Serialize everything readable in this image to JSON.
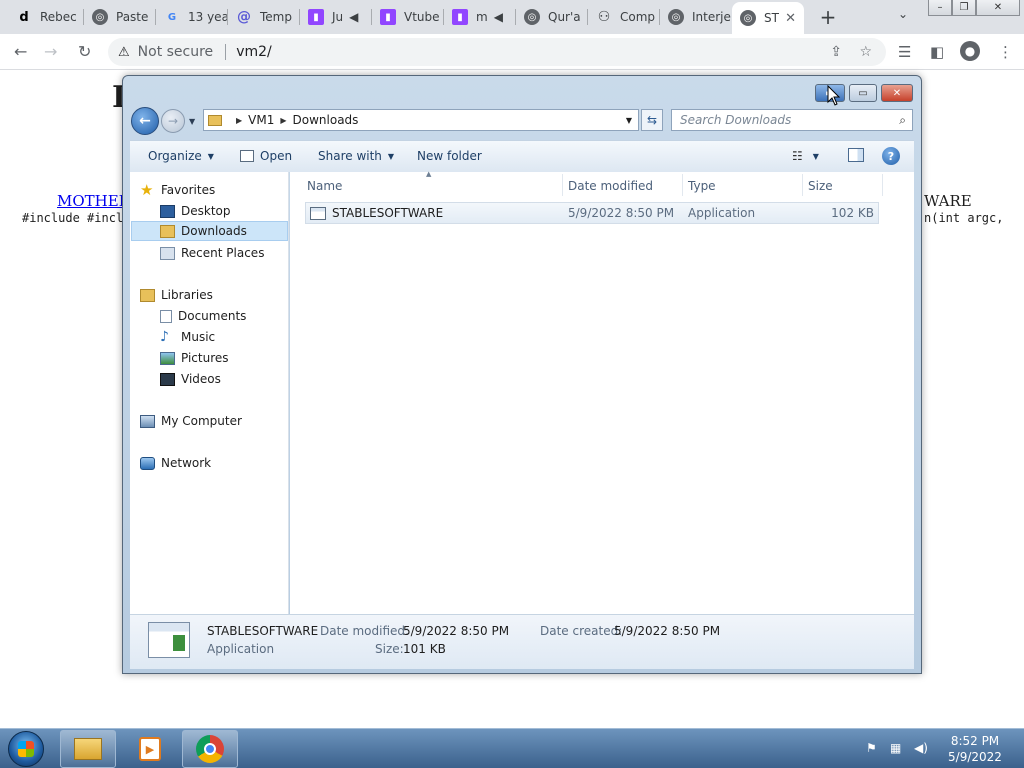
{
  "browser": {
    "tabs": [
      {
        "label": "Rebec",
        "favicon": "letter-d-icon",
        "fav_text": "d"
      },
      {
        "label": "Paste",
        "favicon": "globe-icon"
      },
      {
        "label": "13 yea",
        "favicon": "google-g-icon",
        "fav_text": "G"
      },
      {
        "label": "Temp",
        "favicon": "at-sign-icon",
        "fav_text": "@"
      },
      {
        "label": "Ju",
        "favicon": "twitch-icon",
        "audio": true
      },
      {
        "label": "Vtube",
        "favicon": "twitch-icon"
      },
      {
        "label": "m",
        "favicon": "twitch-icon",
        "audio": true
      },
      {
        "label": "Qur'a",
        "favicon": "globe-icon"
      },
      {
        "label": "Comp",
        "favicon": "app-icon"
      },
      {
        "label": "Interje",
        "favicon": "globe-icon"
      },
      {
        "label": "ST",
        "favicon": "globe-icon",
        "active": true
      }
    ],
    "address": {
      "security": "Not secure",
      "url": "vm2/"
    }
  },
  "webpage": {
    "heading_fragment": "I",
    "link_left": "MOTHER",
    "text_right": "WARE",
    "code_left": "#include #incl",
    "code_right": "n(int argc,"
  },
  "explorer": {
    "breadcrumb": [
      "VM1",
      "Downloads"
    ],
    "search_placeholder": "Search Downloads",
    "commands": {
      "organize": "Organize",
      "open": "Open",
      "share": "Share with",
      "new_folder": "New folder"
    },
    "nav": {
      "favorites": "Favorites",
      "desktop": "Desktop",
      "downloads": "Downloads",
      "recent": "Recent Places",
      "libraries": "Libraries",
      "documents": "Documents",
      "music": "Music",
      "pictures": "Pictures",
      "videos": "Videos",
      "computer": "My Computer",
      "network": "Network"
    },
    "columns": {
      "name": "Name",
      "date": "Date modified",
      "type": "Type",
      "size": "Size"
    },
    "files": [
      {
        "name": "STABLESOFTWARE",
        "date": "5/9/2022 8:50 PM",
        "type": "Application",
        "size": "102 KB"
      }
    ],
    "details": {
      "name": "STABLESOFTWARE",
      "type": "Application",
      "modified_label": "Date modified:",
      "modified": "5/9/2022 8:50 PM",
      "created_label": "Date created:",
      "created": "5/9/2022 8:50 PM",
      "size_label": "Size:",
      "size": "101 KB"
    }
  },
  "taskbar": {
    "time": "8:52 PM",
    "date": "5/9/2022"
  },
  "colors": {
    "selection": "#cce5f9",
    "taskbar": "#3b618c",
    "accent": "#1e5a9e"
  }
}
